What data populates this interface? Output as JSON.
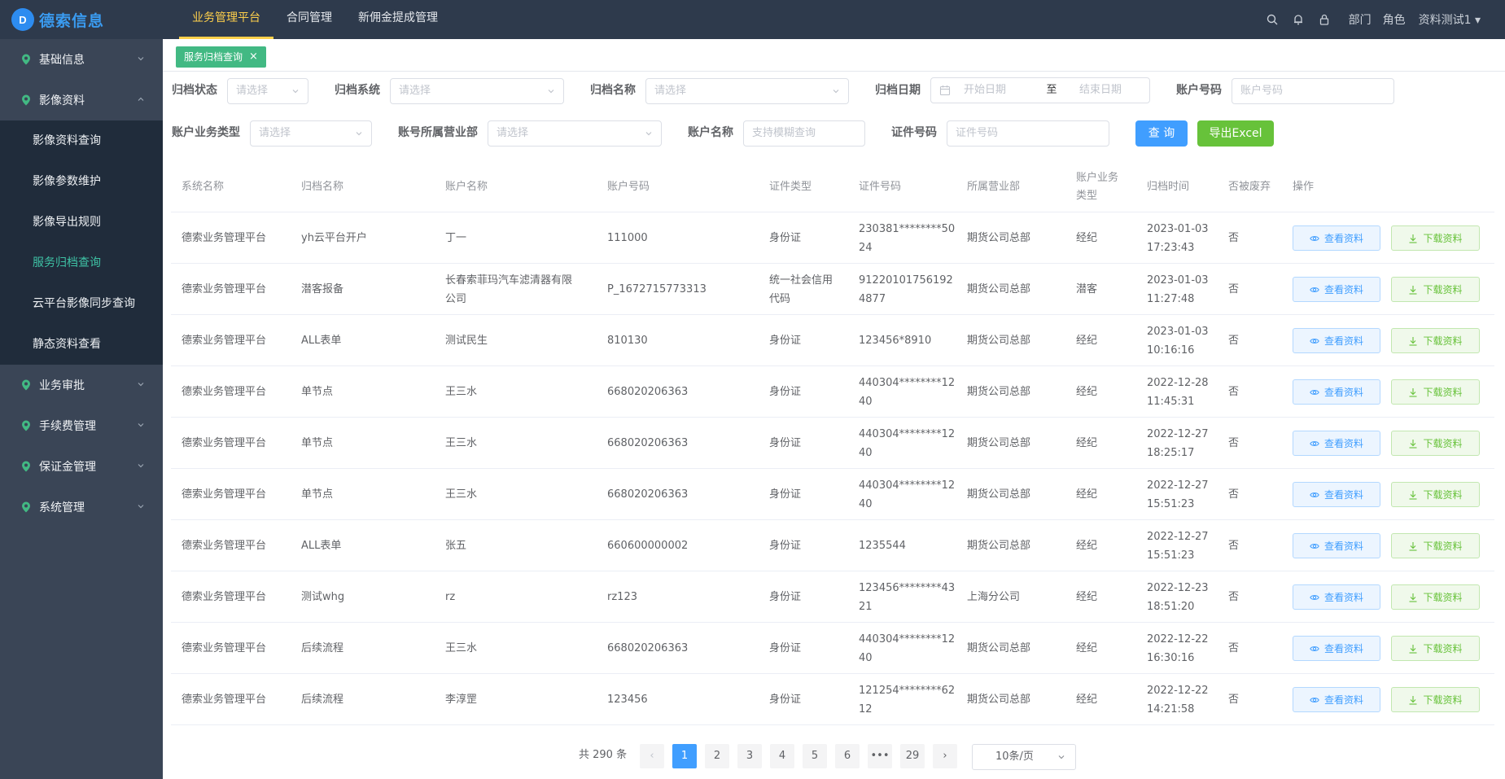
{
  "app": {
    "logo_mark": "D",
    "logo_text": "德索信息"
  },
  "topnav": [
    {
      "label": "业务管理平台",
      "active": true
    },
    {
      "label": "合同管理",
      "active": false
    },
    {
      "label": "新佣金提成管理",
      "active": false
    }
  ],
  "topright": {
    "dept": "部门",
    "role": "角色",
    "user": "资料测试1"
  },
  "sidebar": {
    "basic": "基础信息",
    "image": "影像资料",
    "image_items": [
      "影像资料查询",
      "影像参数维护",
      "影像导出规则",
      "服务归档查询",
      "云平台影像同步查询",
      "静态资料查看"
    ],
    "active_index": 3,
    "approve": "业务审批",
    "fee": "手续费管理",
    "deposit": "保证金管理",
    "system": "系统管理"
  },
  "tag": {
    "label": "服务归档查询",
    "close": "×"
  },
  "filters": {
    "status_label": "归档状态",
    "status_ph": "请选择",
    "system_label": "归档系统",
    "system_ph": "请选择",
    "name_label": "归档名称",
    "name_ph": "请选择",
    "date_label": "归档日期",
    "date_start": "开始日期",
    "date_to": "至",
    "date_end": "结束日期",
    "acct_no_label": "账户号码",
    "acct_no_ph": "账户号码",
    "biz_type_label": "账户业务类型",
    "biz_type_ph": "请选择",
    "dept_label": "账号所属营业部",
    "dept_ph": "请选择",
    "acct_name_label": "账户名称",
    "acct_name_ph": "支持模糊查询",
    "cert_no_label": "证件号码",
    "cert_no_ph": "证件号码",
    "query_btn": "查 询",
    "export_btn": "导出Excel"
  },
  "table": {
    "headers": [
      "系统名称",
      "归档名称",
      "账户名称",
      "账户号码",
      "证件类型",
      "证件号码",
      "所属营业部",
      "账户业务\n类型",
      "归档时间",
      "否被废弃",
      "操作"
    ],
    "view_label": "查看资料",
    "download_label": "下载资料",
    "rows": [
      [
        "德索业务管理平台",
        "yh云平台开户",
        "丁一",
        "111000",
        "身份证",
        "230381********50\n24",
        "期货公司总部",
        "经纪",
        "2023-01-03\n17:23:43",
        "否"
      ],
      [
        "德索业务管理平台",
        "潜客报备",
        "长春索菲玛汽车滤清器有限\n公司",
        "P_1672715773313",
        "统一社会信用\n代码",
        "91220101756192\n4877",
        "期货公司总部",
        "潜客",
        "2023-01-03\n11:27:48",
        "否"
      ],
      [
        "德索业务管理平台",
        "ALL表单",
        "测试民生",
        "810130",
        "身份证",
        "123456*8910",
        "期货公司总部",
        "经纪",
        "2023-01-03\n10:16:16",
        "否"
      ],
      [
        "德索业务管理平台",
        "单节点",
        "王三水",
        "668020206363",
        "身份证",
        "440304********12\n40",
        "期货公司总部",
        "经纪",
        "2022-12-28\n11:45:31",
        "否"
      ],
      [
        "德索业务管理平台",
        "单节点",
        "王三水",
        "668020206363",
        "身份证",
        "440304********12\n40",
        "期货公司总部",
        "经纪",
        "2022-12-27\n18:25:17",
        "否"
      ],
      [
        "德索业务管理平台",
        "单节点",
        "王三水",
        "668020206363",
        "身份证",
        "440304********12\n40",
        "期货公司总部",
        "经纪",
        "2022-12-27\n15:51:23",
        "否"
      ],
      [
        "德索业务管理平台",
        "ALL表单",
        "张五",
        "660600000002",
        "身份证",
        "1235544",
        "期货公司总部",
        "经纪",
        "2022-12-27\n15:51:23",
        "否"
      ],
      [
        "德索业务管理平台",
        "测试whg",
        "rz",
        "rz123",
        "身份证",
        "123456********43\n21",
        "上海分公司",
        "经纪",
        "2022-12-23\n18:51:20",
        "否"
      ],
      [
        "德索业务管理平台",
        "后续流程",
        "王三水",
        "668020206363",
        "身份证",
        "440304********12\n40",
        "期货公司总部",
        "经纪",
        "2022-12-22\n16:30:16",
        "否"
      ],
      [
        "德索业务管理平台",
        "后续流程",
        "李淳罡",
        "123456",
        "身份证",
        "121254********62\n12",
        "期货公司总部",
        "经纪",
        "2022-12-22\n14:21:58",
        "否"
      ]
    ]
  },
  "pagination": {
    "total": "共 290 条",
    "prev": "‹",
    "pages": [
      "1",
      "2",
      "3",
      "4",
      "5",
      "6",
      "•••",
      "29"
    ],
    "current": "1",
    "next": "›",
    "page_size": "10条/页"
  },
  "colors": {
    "topbar": "#2e3a4c",
    "sidebar": "#3a4556",
    "submenu": "#202c3b",
    "accent": "#ffd04b",
    "active_green": "#3ec1a4",
    "primary": "#409eff",
    "success": "#67c23a"
  }
}
